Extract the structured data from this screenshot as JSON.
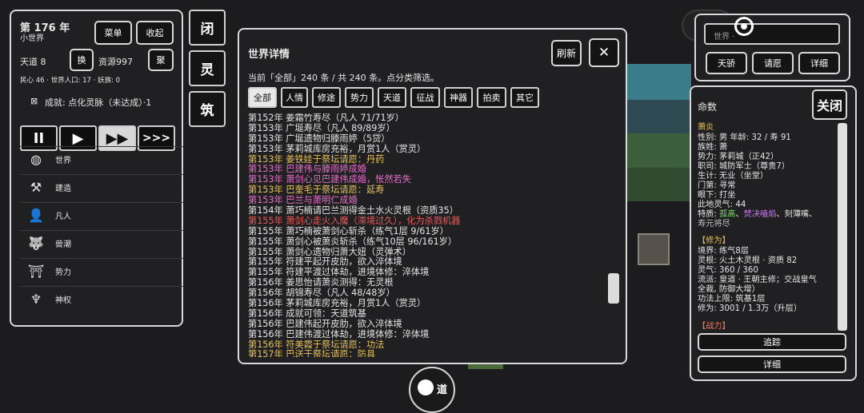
{
  "left": {
    "year": "第 176 年",
    "world_name": "小世界",
    "menu_btn": "菜单",
    "collapse_btn": "收起",
    "tiandao_label": "天道 8",
    "swap_btn": "换",
    "resource": "资源997",
    "gather_btn": "聚",
    "stats": "民心 46 · 世界人口: 17 · 妖族: 0",
    "achievement": "成就: 点化灵脉（未达成）·1",
    "speeds": [
      "II",
      "▶",
      "▶▶",
      ">>>"
    ],
    "menu": [
      {
        "icon": "globe-icon",
        "glyph": "◍",
        "label": "世界"
      },
      {
        "icon": "hammer-icon",
        "glyph": "⚒",
        "label": "建造"
      },
      {
        "icon": "person-icon",
        "glyph": "👤",
        "label": "凡人"
      },
      {
        "icon": "beast-icon",
        "glyph": "🐺",
        "label": "兽潮"
      },
      {
        "icon": "banner-icon",
        "glyph": "⛩",
        "label": "势力"
      },
      {
        "icon": "divine-icon",
        "glyph": "♆",
        "label": "神权"
      }
    ]
  },
  "side_buttons": [
    "闭",
    "灵",
    "筑"
  ],
  "world": {
    "title": "世界详情",
    "refresh_btn": "刷新",
    "close_btn": "✕",
    "summary": "当前「全部」240 条 / 共 240 条。点分类筛选。",
    "filters": [
      "全部",
      "人情",
      "修途",
      "势力",
      "天道",
      "征战",
      "神器",
      "拍卖",
      "其它"
    ],
    "log": [
      {
        "text": "第152年 姜霜竹寿尽（凡人 71/71岁）",
        "color": "#e6e6e6"
      },
      {
        "text": "第153年 广埏寿尽（凡人 89/89岁）",
        "color": "#e6e6e6"
      },
      {
        "text": "第153年 广埏遗物归滕雨婷（5贷）",
        "color": "#e6e6e6"
      },
      {
        "text": "第153年 茅莉城库房充裕，月赏1人（赏灵）",
        "color": "#e6e6e6"
      },
      {
        "text": "第153年 姜铁娃于祭坛请愿：丹药",
        "color": "#e8c15a"
      },
      {
        "text": "第153年 巴建伟与滕雨婷成婚",
        "color": "#e66fc9"
      },
      {
        "text": "第153年 萧剑心见巴建伟成婚，怅然若失",
        "color": "#e66fc9"
      },
      {
        "text": "第153年 巴奎毛于祭坛请愿：延寿",
        "color": "#e8c15a"
      },
      {
        "text": "第153年 巴兰与萧明仁成婚",
        "color": "#e66fc9"
      },
      {
        "text": "第154年 萧巧楠请巴兰测得金土水火灵根（资质35）",
        "color": "#e6e6e6"
      },
      {
        "text": "第155年 萧剑心走火入魔（滞境过久），化为杀戮机器",
        "color": "#ee5a5a"
      },
      {
        "text": "第155年 萧巧楠被萧剑心斩杀（练气1层 9/61岁）",
        "color": "#e6e6e6"
      },
      {
        "text": "第155年 萧剑心被萧炎斩杀（练气10层 96/161岁）",
        "color": "#e6e6e6"
      },
      {
        "text": "第155年 萧剑心遗物归萧大妞（灵弹术）",
        "color": "#e6e6e6"
      },
      {
        "text": "第155年 符建平起开皮肋，欲入淬体境",
        "color": "#e6e6e6"
      },
      {
        "text": "第155年 符建平渡过体劫，进境体修：淬体境",
        "color": "#e6e6e6"
      },
      {
        "text": "第156年 姜思怡请萧炎测得：无灵根",
        "color": "#e6e6e6"
      },
      {
        "text": "第156年 胡锦寿尽（凡人 48/48岁）",
        "color": "#e6e6e6"
      },
      {
        "text": "第156年 茅莉城库房充裕，月赏1人（赏灵）",
        "color": "#e6e6e6"
      },
      {
        "text": "第156年 成就可领：天道筑基",
        "color": "#e6e6e6"
      },
      {
        "text": "第156年 巴建伟起开皮肋，欲入淬体境",
        "color": "#e6e6e6"
      },
      {
        "text": "第156年 巴建伟渡过体劫，进境体修：淬体境",
        "color": "#e6e6e6"
      },
      {
        "text": "第156年 符美霞于祭坛请愿：功法",
        "color": "#e8c15a"
      },
      {
        "text": "第157年 巴送于祭坛请愿：防具",
        "color": "#e8c15a"
      }
    ]
  },
  "topright": {
    "search_placeholder": "世界 ·",
    "btns": [
      "天骄",
      "请愿",
      "详细"
    ]
  },
  "detail": {
    "title": "命数",
    "close_btn": "关闭",
    "name": "萧炎",
    "lines": [
      {
        "text": "性别: 男  年龄: 32 / 寿 91",
        "color": "#e6e6e6"
      },
      {
        "text": "族姓: 萧",
        "color": "#e6e6e6"
      },
      {
        "text": "势力: 茅莉城（正42）",
        "color": "#e6e6e6"
      },
      {
        "text": "职司: 城防军士（尊贵7）",
        "color": "#e6e6e6"
      },
      {
        "text": "生计: 无业（坐堂）",
        "color": "#e6e6e6"
      },
      {
        "text": "门第: 寻常",
        "color": "#e6e6e6"
      },
      {
        "text": "眼下: 打坐",
        "color": "#e6e6e6"
      },
      {
        "text": "此地灵气: 44",
        "color": "#e6e6e6"
      }
    ],
    "traits_label": "特质: ",
    "traits": [
      {
        "text": "孤高",
        "color": "#7ddc6a"
      },
      {
        "text": "、",
        "color": "#e6e6e6"
      },
      {
        "text": "焚决嗑焰",
        "color": "#c97ef0"
      },
      {
        "text": "、刻薄嘴、",
        "color": "#e6e6e6"
      }
    ],
    "traits2": "寿元将尽",
    "cult_header": "【修为】",
    "cult_lines": [
      "境界: 练气8层",
      "灵根: 火土木灵根 · 资质 82",
      "灵气: 360 / 360",
      "流派: 皇道 · 王朝主修；交战皇气",
      "全裁, 防御大增）",
      "功法上限: 筑基1层",
      "修为: 3001 / 1.3万（升层）"
    ],
    "battle_header": "【战力】",
    "track_btn": "追踪",
    "detail_btn": "详细"
  },
  "bottom_btn": "道"
}
